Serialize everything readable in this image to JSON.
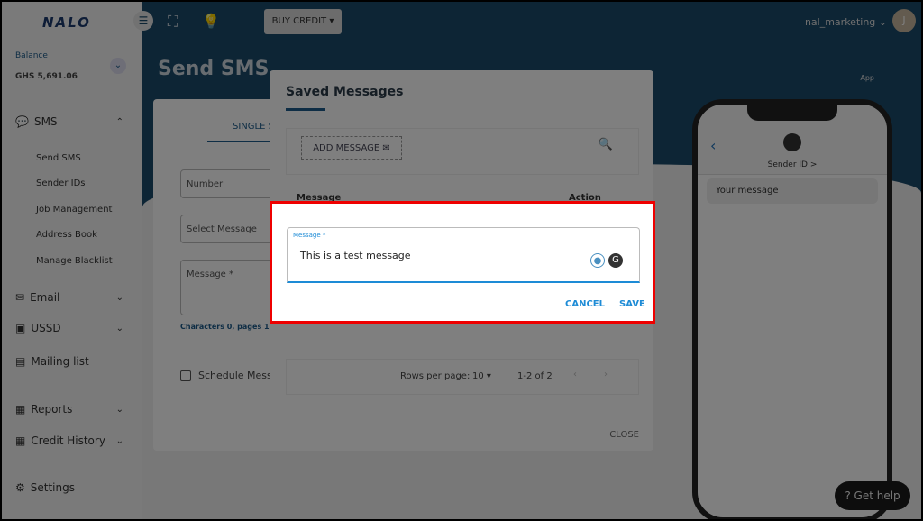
{
  "logo": "NALO",
  "balance": {
    "label": "Balance",
    "value": "GHS 5,691.06"
  },
  "sidebar": {
    "items": [
      {
        "label": "SMS"
      },
      {
        "label": "Email"
      },
      {
        "label": "USSD"
      },
      {
        "label": "Mailing list"
      },
      {
        "label": "Reports"
      },
      {
        "label": "Credit History"
      },
      {
        "label": "Settings"
      }
    ],
    "sub": [
      "Send SMS",
      "Sender IDs",
      "Job Management",
      "Address Book",
      "Manage Blacklist"
    ]
  },
  "header": {
    "buy_credit": "BUY CREDIT",
    "user": "nal_marketing",
    "avatar": "J",
    "crumb": "App"
  },
  "page": {
    "title": "Send SMS",
    "tab": "SINGLE S",
    "number": "Number",
    "select": "Select Message",
    "message": "Message *",
    "chars": "Characters 0, pages 1",
    "schedule": "Schedule Mess"
  },
  "phone": {
    "sender": "Sender ID >",
    "message": "Your message"
  },
  "help": "Get help",
  "dialog": {
    "title": "Saved Messages",
    "add": "ADD MESSAGE",
    "col_message": "Message",
    "col_action": "Action",
    "rows_label": "Rows per page:",
    "rows_value": "10",
    "range": "1-2 of 2",
    "close": "CLOSE"
  },
  "edit": {
    "label": "Message *",
    "value": "This is a test message",
    "cancel": "CANCEL",
    "save": "SAVE"
  },
  "colors": {
    "header": "#1b4a6b",
    "accent": "#1d8bd6",
    "highlight": "#e00000"
  }
}
